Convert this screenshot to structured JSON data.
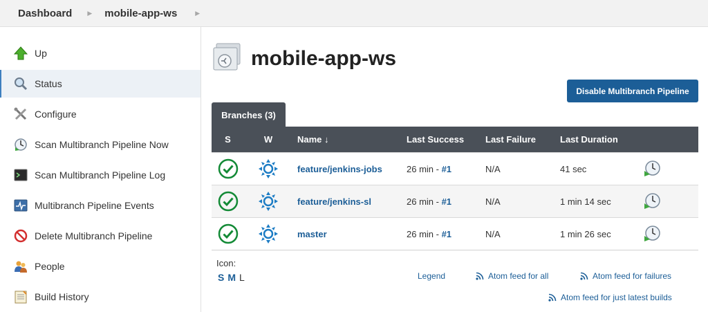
{
  "breadcrumb": {
    "items": [
      "Dashboard",
      "mobile-app-ws"
    ]
  },
  "sidebar": {
    "items": [
      {
        "label": "Up",
        "icon": "up-arrow-icon"
      },
      {
        "label": "Status",
        "icon": "magnifier-icon",
        "active": true
      },
      {
        "label": "Configure",
        "icon": "wrench-screwdriver-icon"
      },
      {
        "label": "Scan Multibranch Pipeline Now",
        "icon": "clock-scan-icon"
      },
      {
        "label": "Scan Multibranch Pipeline Log",
        "icon": "terminal-icon"
      },
      {
        "label": "Multibranch Pipeline Events",
        "icon": "events-monitor-icon"
      },
      {
        "label": "Delete Multibranch Pipeline",
        "icon": "no-entry-icon"
      },
      {
        "label": "People",
        "icon": "people-icon"
      },
      {
        "label": "Build History",
        "icon": "notepad-icon"
      }
    ]
  },
  "main": {
    "title": "mobile-app-ws",
    "disable_button": "Disable Multibranch Pipeline",
    "tab_label": "Branches (3)"
  },
  "table": {
    "headers": {
      "s": "S",
      "w": "W",
      "name": "Name ↓",
      "last_success": "Last Success",
      "last_failure": "Last Failure",
      "last_duration": "Last Duration"
    },
    "rows": [
      {
        "name": "feature/jenkins-jobs",
        "last_success_time": "26 min - ",
        "last_success_build": "#1",
        "last_failure": "N/A",
        "last_duration": "41 sec"
      },
      {
        "name": "feature/jenkins-sl",
        "last_success_time": "26 min - ",
        "last_success_build": "#1",
        "last_failure": "N/A",
        "last_duration": "1 min 14 sec"
      },
      {
        "name": "master",
        "last_success_time": "26 min - ",
        "last_success_build": "#1",
        "last_failure": "N/A",
        "last_duration": "1 min 26 sec"
      }
    ]
  },
  "footer": {
    "icon_label": "Icon:",
    "sizes": [
      "S",
      "M",
      "L"
    ],
    "legend": "Legend",
    "feed_all": "Atom feed for all",
    "feed_failures": "Atom feed for failures",
    "feed_latest": "Atom feed for just latest builds"
  },
  "colors": {
    "accent": "#1c5e97",
    "header_bg": "#4a5058",
    "success": "#138a36",
    "rss": "#1c5e97"
  }
}
